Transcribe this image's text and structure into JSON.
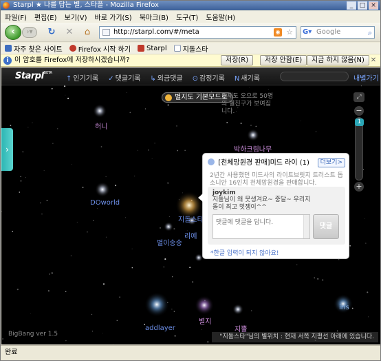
{
  "window": {
    "title": "Starpl ★ 나를 담는 별, 스타플 - Mozilla Firefox"
  },
  "menu": [
    "파일(F)",
    "편집(E)",
    "보기(V)",
    "바로 가기(S)",
    "북마크(B)",
    "도구(T)",
    "도움말(H)"
  ],
  "nav": {
    "url": "http://starpl.com/#/meta",
    "search_placeholder": "Google"
  },
  "bookmarks": [
    {
      "label": "자주 찾은 사이트",
      "color": "#3e6dbf"
    },
    {
      "label": "Firefox 시작 하기",
      "color": "#c0392b"
    },
    {
      "label": "Starpl",
      "color": "#c0392b"
    },
    {
      "label": "지돌스타",
      "color": "#3e6dbf"
    }
  ],
  "notification": {
    "text": "이 암호를 Firefox에 저장하시겠습니까?",
    "save": "저장(R)",
    "never": "저장 안함(E)",
    "not_now": "지금 하지 않음(N)"
  },
  "site": {
    "logo": "Starpl",
    "logo_badge": "BETA",
    "nav_items": [
      {
        "icon": "↑",
        "label": "인기기록"
      },
      {
        "icon": "✓",
        "label": "댓글기록"
      },
      {
        "icon": "↳",
        "label": "외금댓글"
      },
      {
        "icon": "⊙",
        "label": "감정기록"
      },
      {
        "icon": "N",
        "label": "새기록"
      }
    ],
    "mypage": "내별가기",
    "mode_button": "별지도 기본모드로",
    "mode_hint": "현재도 오으로 50명의 별친구가 보여집니다."
  },
  "stars": [
    {
      "label": "허니",
      "color_class": "lbl-pink"
    },
    {
      "label": "박하크림나무",
      "color_class": "lbl-pink"
    },
    {
      "label": "DOworld",
      "color_class": "lbl-blue"
    },
    {
      "label": "지돌스타",
      "color_class": "lbl-blue"
    },
    {
      "label": "리예",
      "color_class": "lbl-blue"
    },
    {
      "label": "별이송송",
      "color_class": "lbl-blue"
    },
    {
      "label": "addlayer",
      "color_class": "lbl-blue"
    },
    {
      "label": "별지",
      "color_class": "lbl-pink"
    },
    {
      "label": "지뿔",
      "color_class": "lbl-pink"
    },
    {
      "label": "iris",
      "color_class": "lbl-lightblue"
    }
  ],
  "zoom": {
    "level": "1",
    "value": 0.06
  },
  "popup": {
    "title": "[천체망원경 판매]미드 라이 (1)",
    "more": "더보기>",
    "description": "2년간 사용했던 미드사의 라이트브릿지 트러스트 돕소니안 16인치 천체망원경을 판매합니다.",
    "comment_user": "joykim",
    "comment_text": "지돌님이 왜 뭇생겨요~ 중달~ 우리지돌이 최고 멋쟁이^^",
    "input_placeholder": "댓글에 댓글을 답니다.",
    "submit": "댓글",
    "note": "*한글 입력이 되지 않아요!"
  },
  "footer": {
    "version": "BigBang ver 1.5",
    "location": "\"지돌스타\"님의 별위치 : 현재 서쪽 지평선 아래에 있습니다."
  },
  "status": "완료"
}
